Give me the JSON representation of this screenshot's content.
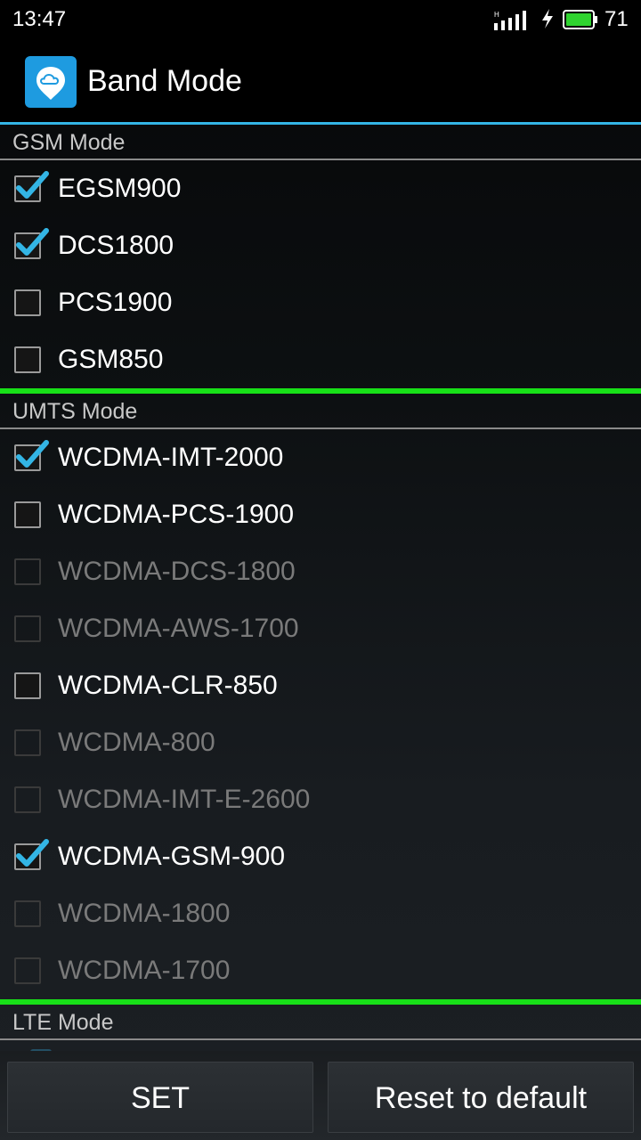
{
  "status_bar": {
    "time": "13:47",
    "network_type": "H",
    "battery_level": "71",
    "battery_color": "#2fd42f"
  },
  "action_bar": {
    "title": "Band Mode",
    "icon": "cloud-location-icon",
    "accent_color": "#33b5e5"
  },
  "sections": {
    "gsm": {
      "title": "GSM Mode",
      "items": [
        {
          "label": "EGSM900",
          "checked": true,
          "enabled": true
        },
        {
          "label": "DCS1800",
          "checked": true,
          "enabled": true
        },
        {
          "label": "PCS1900",
          "checked": false,
          "enabled": true
        },
        {
          "label": "GSM850",
          "checked": false,
          "enabled": true
        }
      ]
    },
    "umts": {
      "title": "UMTS Mode",
      "items": [
        {
          "label": "WCDMA-IMT-2000",
          "checked": true,
          "enabled": true
        },
        {
          "label": "WCDMA-PCS-1900",
          "checked": false,
          "enabled": true
        },
        {
          "label": "WCDMA-DCS-1800",
          "checked": false,
          "enabled": false
        },
        {
          "label": "WCDMA-AWS-1700",
          "checked": false,
          "enabled": false
        },
        {
          "label": "WCDMA-CLR-850",
          "checked": false,
          "enabled": true
        },
        {
          "label": "WCDMA-800",
          "checked": false,
          "enabled": false
        },
        {
          "label": "WCDMA-IMT-E-2600",
          "checked": false,
          "enabled": false
        },
        {
          "label": "WCDMA-GSM-900",
          "checked": true,
          "enabled": true
        },
        {
          "label": "WCDMA-1800",
          "checked": false,
          "enabled": false
        },
        {
          "label": "WCDMA-1700",
          "checked": false,
          "enabled": false
        }
      ]
    },
    "lte": {
      "title": "LTE Mode"
    }
  },
  "buttons": {
    "set_label": "SET",
    "reset_label": "Reset to default"
  },
  "colors": {
    "check": "#33b5e5",
    "separator": "#18e018"
  }
}
